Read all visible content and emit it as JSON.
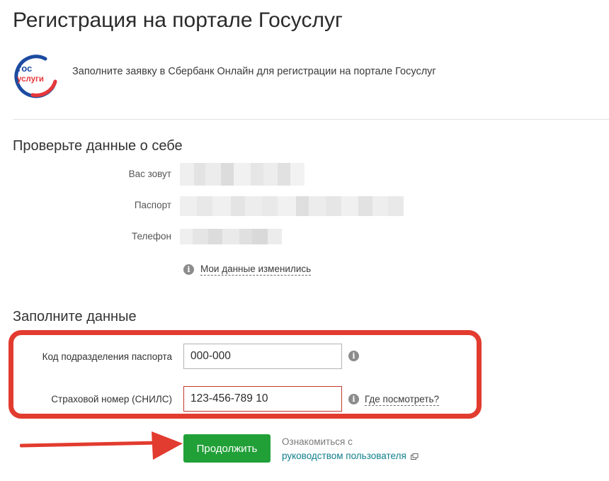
{
  "page": {
    "title": "Регистрация на портале Госуслуг",
    "intro_text": "Заполните заявку в Сбербанк Онлайн для регистрации на портале Госуслуг",
    "logo_text": [
      "гос",
      "услуги"
    ]
  },
  "check_section": {
    "title": "Проверьте данные о себе",
    "rows": [
      {
        "label": "Вас зовут"
      },
      {
        "label": "Паспорт"
      },
      {
        "label": "Телефон"
      }
    ],
    "changed_link": "Мои данные изменились"
  },
  "fill_section": {
    "title": "Заполните данные",
    "passport_code": {
      "label": "Код подразделения паспорта",
      "value": "000-000"
    },
    "snils": {
      "label": "Страховой номер (СНИЛС)",
      "value": "123-456-789 10",
      "help_link": "Где посмотреть?"
    }
  },
  "actions": {
    "continue_label": "Продолжить",
    "guide_prefix": "Ознакомиться с",
    "guide_link": "руководством пользователя"
  },
  "colors": {
    "accent_green": "#21a038",
    "highlight_red": "#e23b2f",
    "logo_blue": "#1c4ba0",
    "logo_red": "#e5383b",
    "link_teal": "#107f8c"
  }
}
